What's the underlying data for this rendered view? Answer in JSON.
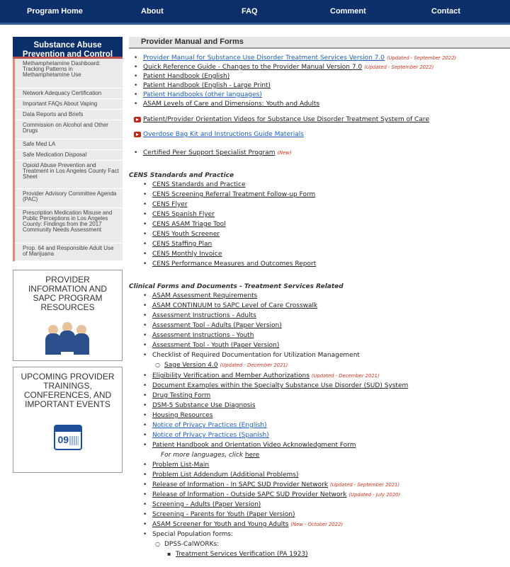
{
  "nav": {
    "items": [
      "Program Home",
      "About",
      "FAQ",
      "Comment",
      "Contact"
    ]
  },
  "sidebar": {
    "header": "Substance Abuse Prevention and Control",
    "items": [
      "Methamphetamine Dashboard: Tracking Patterns in Methamphetamine Use",
      "Network Adequacy Certification",
      "Important FAQs About Vaping",
      "Data Reports and Briefs",
      "Commission on Alcohol and Other Drugs",
      "Safe Med LA",
      "Safe Medication Disposal",
      "Opioid Abuse Prevention and Treatment in Los Angeles County Fact Sheet",
      "Provider Advisory Committee Agenda (PAC)",
      "Prescription Medication Misuse and Public Perceptions in Los Angeles County: Findings from the 2017 Community Needs Assessment",
      "Prop. 64 and Responsible Adult Use of Marijuana"
    ],
    "provider_box": "PROVIDER INFORMATION AND SAPC PROGRAM RESOURCES",
    "events_box": "UPCOMING PROVIDER TRAININGS, CONFERENCES, AND IMPORTANT EVENTS",
    "calendar_number": "09"
  },
  "main": {
    "title": "Provider Manual and Forms",
    "manual_links": [
      {
        "text": "Provider Manual for Substance Use Disorder Treatment Services Version 7.0",
        "note": "(Updated - September 2022)",
        "blue": true
      },
      {
        "text": "Quick Reference Guide - Changes to the Provider Manual Version 7.0",
        "note": "(Updated - September 2022)",
        "blue": false
      },
      {
        "text": "Patient Handbook (English)",
        "note": "",
        "blue": false
      },
      {
        "text": "Patient Handbook (English - Large Print)",
        "note": "",
        "blue": false
      },
      {
        "text": "Patient Handbooks (other languages)",
        "note": "",
        "blue": true
      },
      {
        "text": "ASAM Levels of Care and Dimensions: Youth and Adults",
        "note": "",
        "blue": false
      }
    ],
    "video_links": [
      {
        "text": "Patient/Provider Orientation Videos for Substance Use Disorder Treatment System of Care",
        "blue": false
      },
      {
        "text": "Overdose Bag Kit and Instructions Guide Materials",
        "blue": true
      }
    ],
    "peer": {
      "text": "Certified Peer Support Specialist Program",
      "note": "(New)"
    },
    "cens_heading": "CENS Standards and Practice",
    "cens_links": [
      "CENS Standards and Practice",
      "CENS Screening Referral Treatment Follow-up Form",
      "CENS Flyer",
      "CENS Spanish Flyer",
      "CENS ASAM Triage Tool",
      "CENS Youth Screener",
      "CENS Staffing Plan",
      "CENS Monthly Invoice",
      "CENS Performance Measures and Outcomes Report"
    ],
    "clinical_heading": "Clinical Forms and Documents - Treatment Services Related",
    "clinical_links_a": [
      "ASAM Assessment Requirements",
      "ASAM CONTINUUM to SAPC Level of Care Crosswalk",
      "Assessment Instructions - Adults",
      "Assessment Tool - Adults (Paper Version)",
      "Assessment Instructions - Youth",
      "Assessment Tool - Youth (Paper Version)"
    ],
    "checklist_text": "Checklist of Required Documentation for Utilization Management",
    "sage": {
      "text": "Sage Version 4.0",
      "note": "(Updated - December 2021)"
    },
    "clinical_links_b": [
      {
        "text": "Eligibility Verification and Member Authorizations",
        "note": "(Updated - December 2021)",
        "blue": false
      },
      {
        "text": "Document Examples within the Specialty Substance Use Disorder (SUD) System",
        "note": "",
        "blue": false
      },
      {
        "text": "Drug Testing Form",
        "note": "",
        "blue": false
      },
      {
        "text": "DSM-5 Substance Use Diagnosis",
        "note": "",
        "blue": false
      },
      {
        "text": "Housing Resources",
        "note": "",
        "blue": false
      },
      {
        "text": "Notice of Privacy Practices (English)",
        "note": "",
        "blue": true
      },
      {
        "text": "Notice of Privacy Practices (Spanish)",
        "note": "",
        "blue": true
      },
      {
        "text": "Patient Handbook and Orientation Video Acknowledgment Form",
        "note": "",
        "blue": false
      }
    ],
    "more_languages": "For more languages, click",
    "here": "here",
    "clinical_links_c": [
      {
        "text": "Problem List-Main",
        "note": ""
      },
      {
        "text": "Problem List Addendum (Additional Problems)",
        "note": ""
      },
      {
        "text": "Release of Information - In SAPC SUD Provider Network",
        "note": "(Updated - September 2021)"
      },
      {
        "text": "Release of Information - Outside SAPC SUD Provider Network",
        "note": "(Updated - July 2020)"
      },
      {
        "text": "Screening - Adults (Paper Version)",
        "note": ""
      },
      {
        "text": "Screening - Parents for Youth (Paper Version)",
        "note": ""
      },
      {
        "text": "ASAM Screener for Youth and Young Adults",
        "note": "(New - October 2022)"
      }
    ],
    "special_pop": "Special Population forms:",
    "dpss": "DPSS-CalWORKs:",
    "treatment": "Treatment Services Verification (PA 1923)"
  }
}
